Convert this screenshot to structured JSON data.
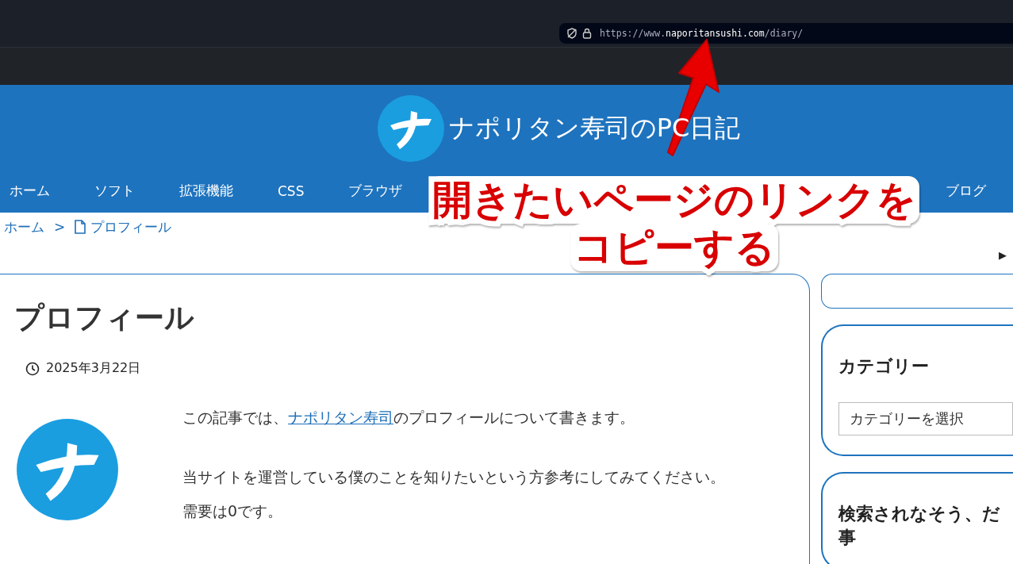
{
  "address_bar": {
    "url_prefix": "https://www.",
    "url_domain": "naporitansushi.com",
    "url_path": "/diary/"
  },
  "site": {
    "title": "ナポリタン寿司のPC日記"
  },
  "nav": [
    {
      "label": "ホーム"
    },
    {
      "label": "ソフト"
    },
    {
      "label": "拡張機能"
    },
    {
      "label": "CSS"
    },
    {
      "label": "ブラウザ"
    },
    {
      "label": "ブログ"
    }
  ],
  "breadcrumb": [
    {
      "label": "ホーム"
    },
    {
      "label": ">"
    },
    {
      "label": "プロフィール",
      "kind": "page"
    }
  ],
  "article": {
    "title": "プロフィール",
    "date": "2025年3月22日",
    "paragraphs": [
      {
        "before": "この記事では、",
        "link": "ナポリタン寿司",
        "after": "のプロフィールについて書きます。"
      },
      {
        "before": "当サイトを運営している僕のことを知りたいという方参考にしてみてください。需要は0です。"
      }
    ]
  },
  "sidebar": {
    "toggle": "▶",
    "category_heading": "カテゴリー",
    "category_select": "カテゴリーを選択",
    "widget_heading": [
      "検索されなそう、だ",
      "事"
    ]
  },
  "annotation": {
    "lines": [
      "開きたいページのリンクを",
      "コピーする"
    ]
  }
}
